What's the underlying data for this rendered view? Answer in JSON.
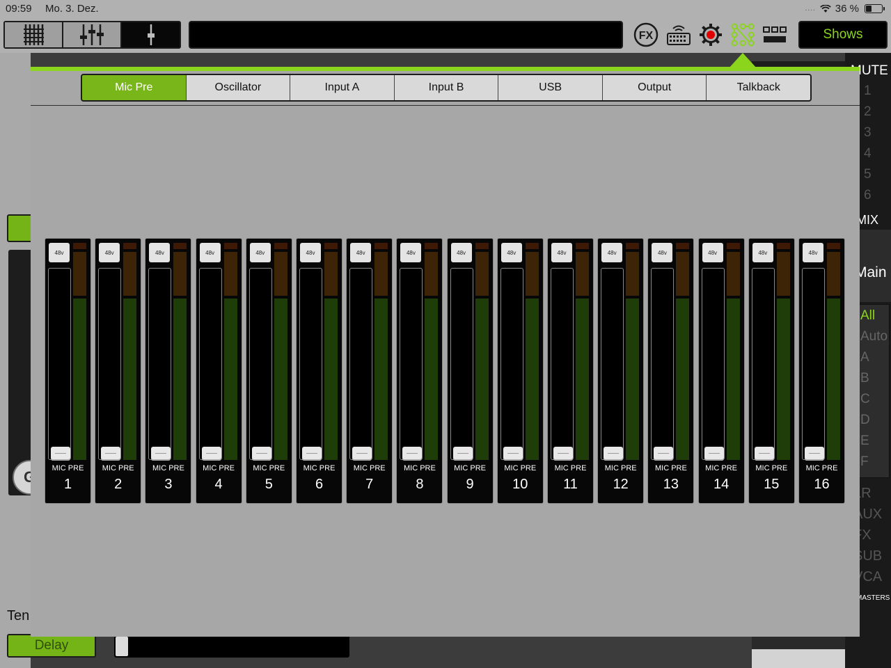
{
  "status_bar": {
    "time": "09:59",
    "date": "Mo. 3. Dez.",
    "signal": "....",
    "battery": "36 %"
  },
  "toolbar": {
    "fx_label": "FX",
    "shows_label": "Shows",
    "icons": [
      "channel-view-icon",
      "mixer-view-icon",
      "single-fader-icon",
      "fx-icon",
      "keyboard-icon",
      "settings-icon",
      "patch-icon",
      "layout-icon"
    ]
  },
  "popup": {
    "tabs": [
      {
        "label": "Mic Pre",
        "active": true
      },
      {
        "label": "Oscillator",
        "active": false
      },
      {
        "label": "Input A",
        "active": false
      },
      {
        "label": "Input B",
        "active": false
      },
      {
        "label": "USB",
        "active": false
      },
      {
        "label": "Output",
        "active": false
      },
      {
        "label": "Talkback",
        "active": false
      }
    ],
    "phantom_label": "48v",
    "strips": [
      {
        "label": "MIC PRE",
        "number": "1"
      },
      {
        "label": "MIC PRE",
        "number": "2"
      },
      {
        "label": "MIC PRE",
        "number": "3"
      },
      {
        "label": "MIC PRE",
        "number": "4"
      },
      {
        "label": "MIC PRE",
        "number": "5"
      },
      {
        "label": "MIC PRE",
        "number": "6"
      },
      {
        "label": "MIC PRE",
        "number": "7"
      },
      {
        "label": "MIC PRE",
        "number": "8"
      },
      {
        "label": "MIC PRE",
        "number": "9"
      },
      {
        "label": "MIC PRE",
        "number": "10"
      },
      {
        "label": "MIC PRE",
        "number": "11"
      },
      {
        "label": "MIC PRE",
        "number": "12"
      },
      {
        "label": "MIC PRE",
        "number": "13"
      },
      {
        "label": "MIC PRE",
        "number": "14"
      },
      {
        "label": "MIC PRE",
        "number": "15"
      },
      {
        "label": "MIC PRE",
        "number": "16"
      }
    ]
  },
  "background": {
    "left_knob_label": "G",
    "left_partial_text": "Ten",
    "delay_label": "Delay",
    "right_panel": {
      "mute_label": "MUTE",
      "mute_groups": [
        "1",
        "2",
        "3",
        "4",
        "5",
        "6"
      ],
      "mix_label": "MIX",
      "main_label": "Main",
      "filters": [
        "All",
        "Auto",
        "A",
        "B",
        "C",
        "D",
        "E",
        "F"
      ],
      "types": [
        "LR",
        "AUX",
        "FX",
        "SUB",
        "VCA"
      ],
      "masters_label": "MASTERS"
    }
  },
  "colors": {
    "accent_green": "#8bd51c",
    "active_tab": "#79b61a",
    "popup_bg": "#a7a7a7",
    "meter_green": "#1f3d08",
    "meter_orange": "#3e2406",
    "meter_red": "#3e1a06"
  }
}
